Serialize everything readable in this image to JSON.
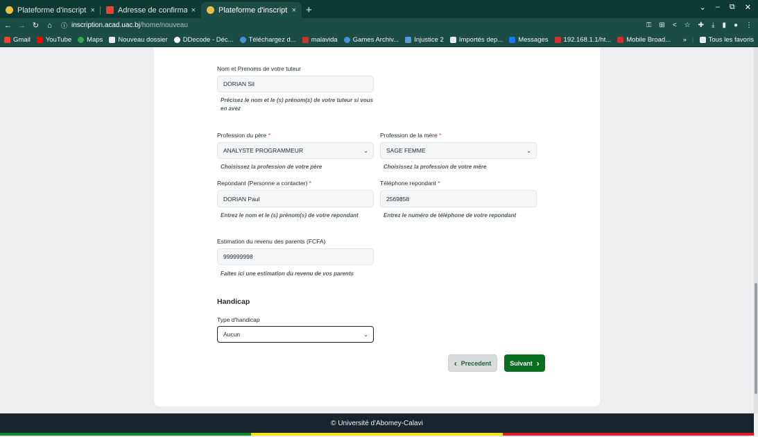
{
  "browser": {
    "tabs": [
      {
        "title": "Plateforme d'inscription",
        "favicon_color": "#e8c046"
      },
      {
        "title": "Adresse de confirmation",
        "favicon_color": "#ea4335"
      },
      {
        "title": "Plateforme d'inscription",
        "favicon_color": "#e8c046"
      }
    ],
    "tab_close": "×",
    "new_tab": "+",
    "url_host": "inscription.acad.uac.bj",
    "url_path": "/home/nouveau",
    "bookmarks": [
      {
        "label": "Gmail",
        "color": "#ea4335"
      },
      {
        "label": "YouTube",
        "color": "#ff0000"
      },
      {
        "label": "Maps",
        "color": "#34a853"
      },
      {
        "label": "Nouveau dossier",
        "color": "#e8eaed"
      },
      {
        "label": "DDecode - Déc...",
        "color": "#ffffff"
      },
      {
        "label": "Téléchargez d...",
        "color": "#4a90d9"
      },
      {
        "label": "malavida",
        "color": "#c0392b"
      },
      {
        "label": "Games Archiv...",
        "color": "#4a90d9"
      },
      {
        "label": "Injustice 2",
        "color": "#5b9bd5"
      },
      {
        "label": "Importés dep...",
        "color": "#e8eaed"
      },
      {
        "label": "Messages",
        "color": "#1877f2"
      },
      {
        "label": "192.168.1.1/ht...",
        "color": "#d32f2f"
      },
      {
        "label": "Mobile Broad...",
        "color": "#d32f2f"
      }
    ],
    "bookmarks_more": "»",
    "all_bookmarks": "Tous les favoris"
  },
  "form": {
    "tutor": {
      "label": "Nom et Prenoms de votre tuteur",
      "value": "DORIAN Sil",
      "hint": "Précisez le nom et le (s) prénom(s) de votre tuteur si vous en avez"
    },
    "father_profession": {
      "label": "Profession du père",
      "required": "*",
      "value": "ANALYSTE PROGRAMMEUR",
      "hint": "Choisissez la profession de votre père"
    },
    "mother_profession": {
      "label": "Profession de la mère",
      "required": "*",
      "value": "SAGE FEMME",
      "hint": "Choisissez la profession de votre mère"
    },
    "contact": {
      "label": "Repondant (Personne a contacter)",
      "required": "*",
      "value": "DORIAN Paul",
      "hint": "Entrez le nom et le (s) prénom(s) de votre repondant"
    },
    "contact_phone": {
      "label": "Téléphone repondant",
      "required": "*",
      "value": "2569858",
      "hint": "Entrez le numéro de téléphone de votre repondant"
    },
    "income": {
      "label": "Estimation du revenu des parents (FCFA)",
      "value": "999999998",
      "hint": "Faites ici une estimation du revenu de vos parents"
    },
    "handicap_section": "Handicap",
    "handicap_type": {
      "label": "Type d'handicap",
      "value": "Aucun"
    },
    "prev_button": "Precedent",
    "next_button": "Suivant"
  },
  "footer": {
    "copyright": "© Université d'Abomey-Calavi",
    "flag_colors": [
      "#0a8a2a",
      "#f4e11c",
      "#e01b24"
    ]
  }
}
